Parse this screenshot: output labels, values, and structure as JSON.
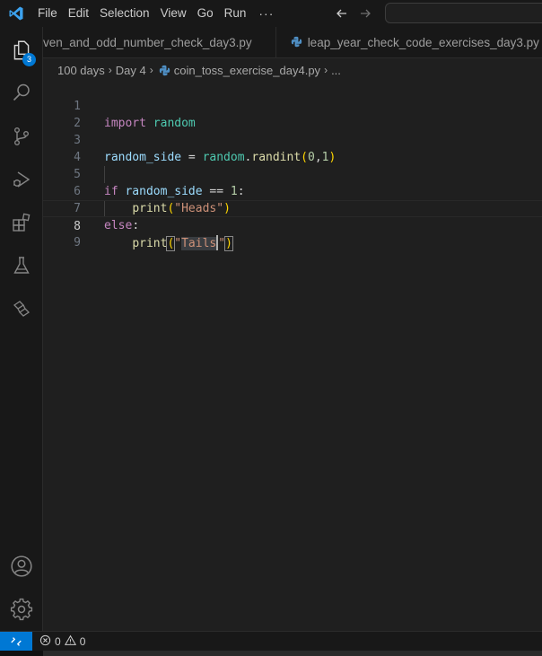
{
  "titlebar": {
    "menu": [
      "File",
      "Edit",
      "Selection",
      "View",
      "Go",
      "Run"
    ],
    "more": "···"
  },
  "activity": {
    "explorer_badge": "3"
  },
  "tabs": [
    {
      "label": "ven_and_odd_number_check_day3.py"
    },
    {
      "label": "leap_year_check_code_exercises_day3.py"
    }
  ],
  "breadcrumb": {
    "items": [
      "100 days",
      "Day 4",
      "coin_toss_exercise_day4.py",
      "..."
    ]
  },
  "editor": {
    "line_numbers": [
      "1",
      "2",
      "3",
      "4",
      "5",
      "6",
      "7",
      "8",
      "9"
    ],
    "active_line": "8",
    "tokens": {
      "l1_import": "import",
      "l1_module": "random",
      "l3_var": "random_side",
      "l3_eq": " = ",
      "l3_mod": "random",
      "l3_dot": ".",
      "l3_fn": "randint",
      "l3_open": "(",
      "l3_a": "0",
      "l3_comma": ",",
      "l3_b": "1",
      "l3_close": ")",
      "l5_if": "if",
      "l5_var": "random_side",
      "l5_op": " == ",
      "l5_num": "1",
      "l5_colon": ":",
      "l6_fn": "print",
      "l6_open": "(",
      "l6_str": "\"Heads\"",
      "l6_close": ")",
      "l7_else": "else",
      "l7_colon": ":",
      "l8_fn": "print",
      "l8_open": "(",
      "l8_q1": "\"",
      "l8_word": "Tails",
      "l8_q2": "\"",
      "l8_close": ")"
    }
  },
  "status": {
    "errors": "0",
    "warnings": "0"
  },
  "colors": {
    "accent": "#0078d4",
    "keyword": "#c586c0",
    "module": "#4ec9b0",
    "variable": "#9cdcfe",
    "function": "#dcdcaa",
    "number": "#b5cea8",
    "string": "#ce9178",
    "bracket": "#ffd700"
  }
}
